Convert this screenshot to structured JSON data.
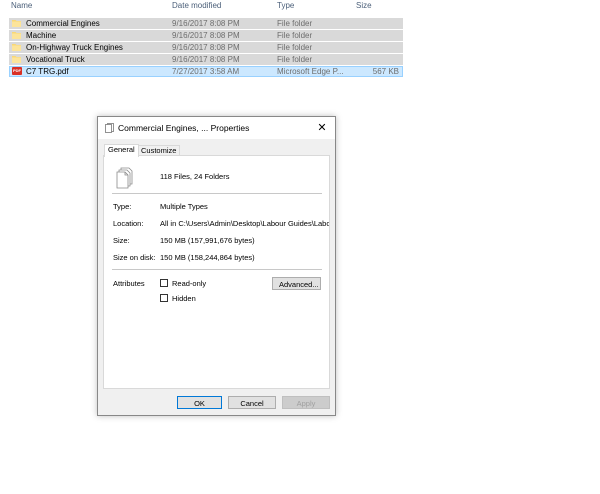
{
  "explorer": {
    "columns": {
      "name": "Name",
      "date": "Date modified",
      "type": "Type",
      "size": "Size"
    },
    "rows": [
      {
        "name": "Commercial Engines",
        "date": "9/16/2017 8:08 PM",
        "type": "File folder",
        "size": "",
        "icon": "folder-icon"
      },
      {
        "name": "Machine",
        "date": "9/16/2017 8:08 PM",
        "type": "File folder",
        "size": "",
        "icon": "folder-icon"
      },
      {
        "name": "On-Highway Truck Engines",
        "date": "9/16/2017 8:08 PM",
        "type": "File folder",
        "size": "",
        "icon": "folder-icon"
      },
      {
        "name": "Vocational Truck",
        "date": "9/16/2017 8:08 PM",
        "type": "File folder",
        "size": "",
        "icon": "folder-icon"
      },
      {
        "name": "C7 TRG.pdf",
        "date": "7/27/2017 3:58 AM",
        "type": "Microsoft Edge P...",
        "size": "567 KB",
        "icon": "pdf-icon",
        "icon_text": "PDF"
      }
    ]
  },
  "dialog": {
    "title": "Commercial Engines, ... Properties",
    "close": "✕",
    "tabs": [
      "General",
      "Customize"
    ],
    "files_count": "118 Files, 24 Folders",
    "type_label": "Type:",
    "type_value": "Multiple Types",
    "location_label": "Location:",
    "location_value": "All in C:\\Users\\Admin\\Desktop\\Labour Guides\\Labou",
    "size_label": "Size:",
    "size_value": "150 MB (157,991,676 bytes)",
    "size_on_disk_label": "Size on disk:",
    "size_on_disk_value": "150 MB (158,244,864 bytes)",
    "attributes_label": "Attributes",
    "read_only": "Read-only",
    "hidden": "Hidden",
    "advanced": "Advanced...",
    "ok": "OK",
    "cancel": "Cancel",
    "apply": "Apply"
  },
  "colors": {
    "folder": "#f8d775",
    "pdf": "#d93025",
    "selection": "#cce8ff",
    "row": "#d9d9d9"
  }
}
